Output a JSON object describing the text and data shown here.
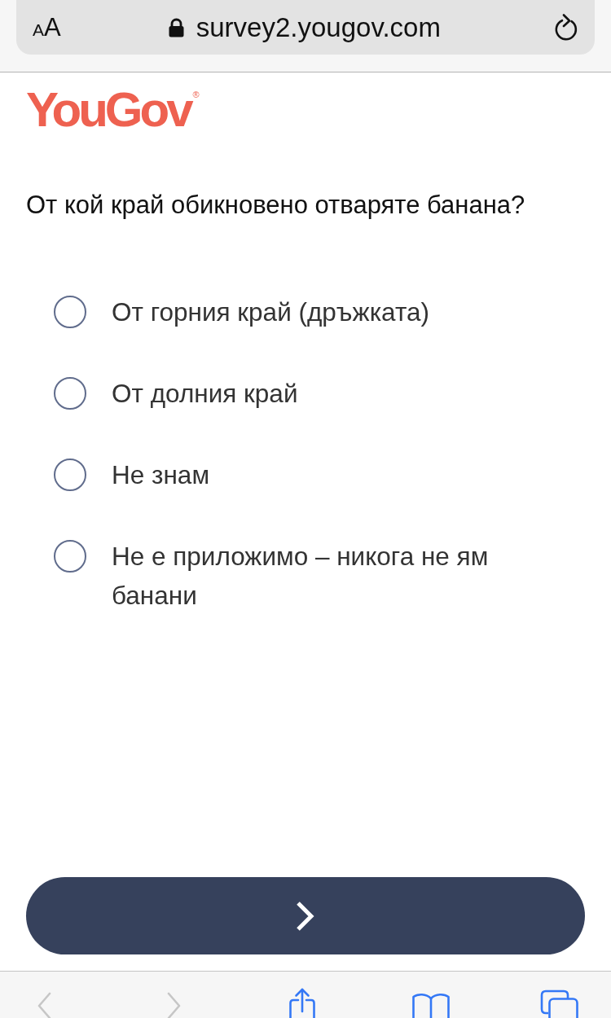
{
  "browser": {
    "text_size_button": {
      "small": "A",
      "large": "A"
    },
    "secure": true,
    "url": "survey2.yougov.com"
  },
  "logo": {
    "text": "YouGov",
    "mark": "®"
  },
  "question": "От кой край обикновено отваряте банана?",
  "options": [
    {
      "label": "От горния край (дръжката)",
      "selected": false
    },
    {
      "label": "От долния край",
      "selected": false
    },
    {
      "label": "Не знам",
      "selected": false
    },
    {
      "label": "Не е приложимо – никога не ям банани",
      "selected": false
    }
  ],
  "toolbar": {
    "items": [
      {
        "kind": "back",
        "disabled": true
      },
      {
        "kind": "forward",
        "disabled": true
      },
      {
        "kind": "share",
        "disabled": false
      },
      {
        "kind": "bookmarks",
        "disabled": false
      },
      {
        "kind": "tabs",
        "disabled": false
      }
    ]
  }
}
